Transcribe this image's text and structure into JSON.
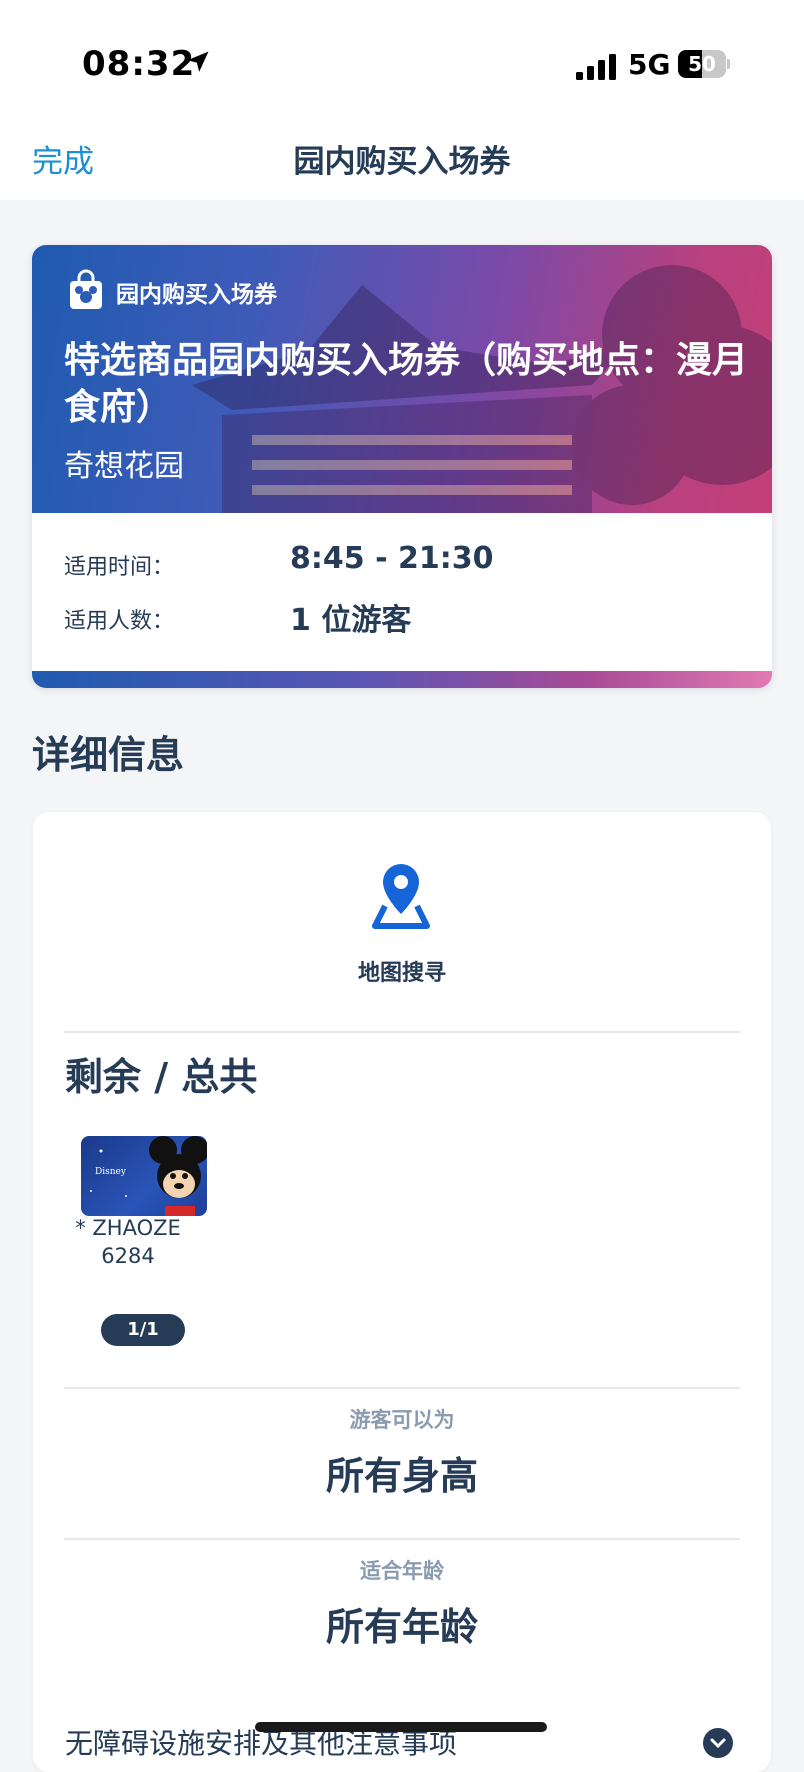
{
  "status_bar": {
    "time": "08:32",
    "network": "5G",
    "battery": "50",
    "battery_level": 0.5
  },
  "nav": {
    "done_label": "完成",
    "title": "园内购买入场券"
  },
  "ticket": {
    "tag": "园内购买入场券",
    "title": "特选商品园内购买入场券（购买地点：漫月食府）",
    "location": "奇想花园",
    "rows": [
      {
        "label": "适用时间：",
        "value": "8:45 - 21:30"
      },
      {
        "label": "适用人数：",
        "value": "1 位游客"
      }
    ]
  },
  "details": {
    "heading": "详细信息",
    "map_label": "地图搜寻",
    "remaining_title": "剩余 / 总共",
    "pass": {
      "name_line1": "* ZHAOZE",
      "name_line2": "6284",
      "badge": "1/1"
    },
    "height": {
      "label": "游客可以为",
      "value": "所有身高"
    },
    "age": {
      "label": "适合年龄",
      "value": "所有年龄"
    },
    "accessibility_label": "无障碍设施安排及其他注意事项"
  },
  "colors": {
    "accent": "#1d8fd6",
    "navy": "#253b56",
    "map_icon": "#1565d8"
  },
  "icons": {
    "location_arrow": "location-arrow-icon",
    "signal": "signal-bars-icon",
    "bag": "shopping-bag-icon",
    "map": "map-pin-icon",
    "chevron": "chevron-down-icon"
  }
}
